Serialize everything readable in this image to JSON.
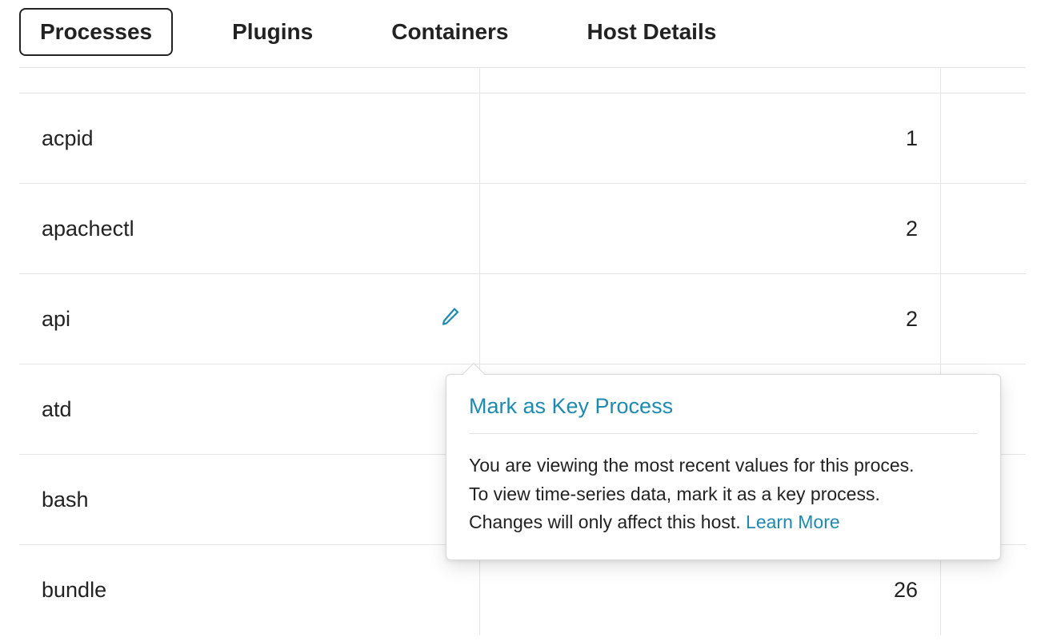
{
  "tabs": [
    {
      "label": "Processes",
      "active": true
    },
    {
      "label": "Plugins",
      "active": false
    },
    {
      "label": "Containers",
      "active": false
    },
    {
      "label": "Host Details",
      "active": false
    }
  ],
  "processes": [
    {
      "name": "acpid",
      "count": 1,
      "show_edit": false
    },
    {
      "name": "apachectl",
      "count": 2,
      "show_edit": false
    },
    {
      "name": "api",
      "count": 2,
      "show_edit": true
    },
    {
      "name": "atd",
      "count": "",
      "show_edit": false
    },
    {
      "name": "bash",
      "count": "",
      "show_edit": false
    },
    {
      "name": "bundle",
      "count": 26,
      "show_edit": false
    }
  ],
  "popover": {
    "title": "Mark as Key Process",
    "body_line1": "You are viewing the most recent values for this proces.",
    "body_line2": "To view time-series data, mark it as a key process.",
    "body_line3_prefix": "Changes will only affect this host. ",
    "learn_more": "Learn More"
  },
  "icons": {
    "edit": "edit-icon"
  }
}
